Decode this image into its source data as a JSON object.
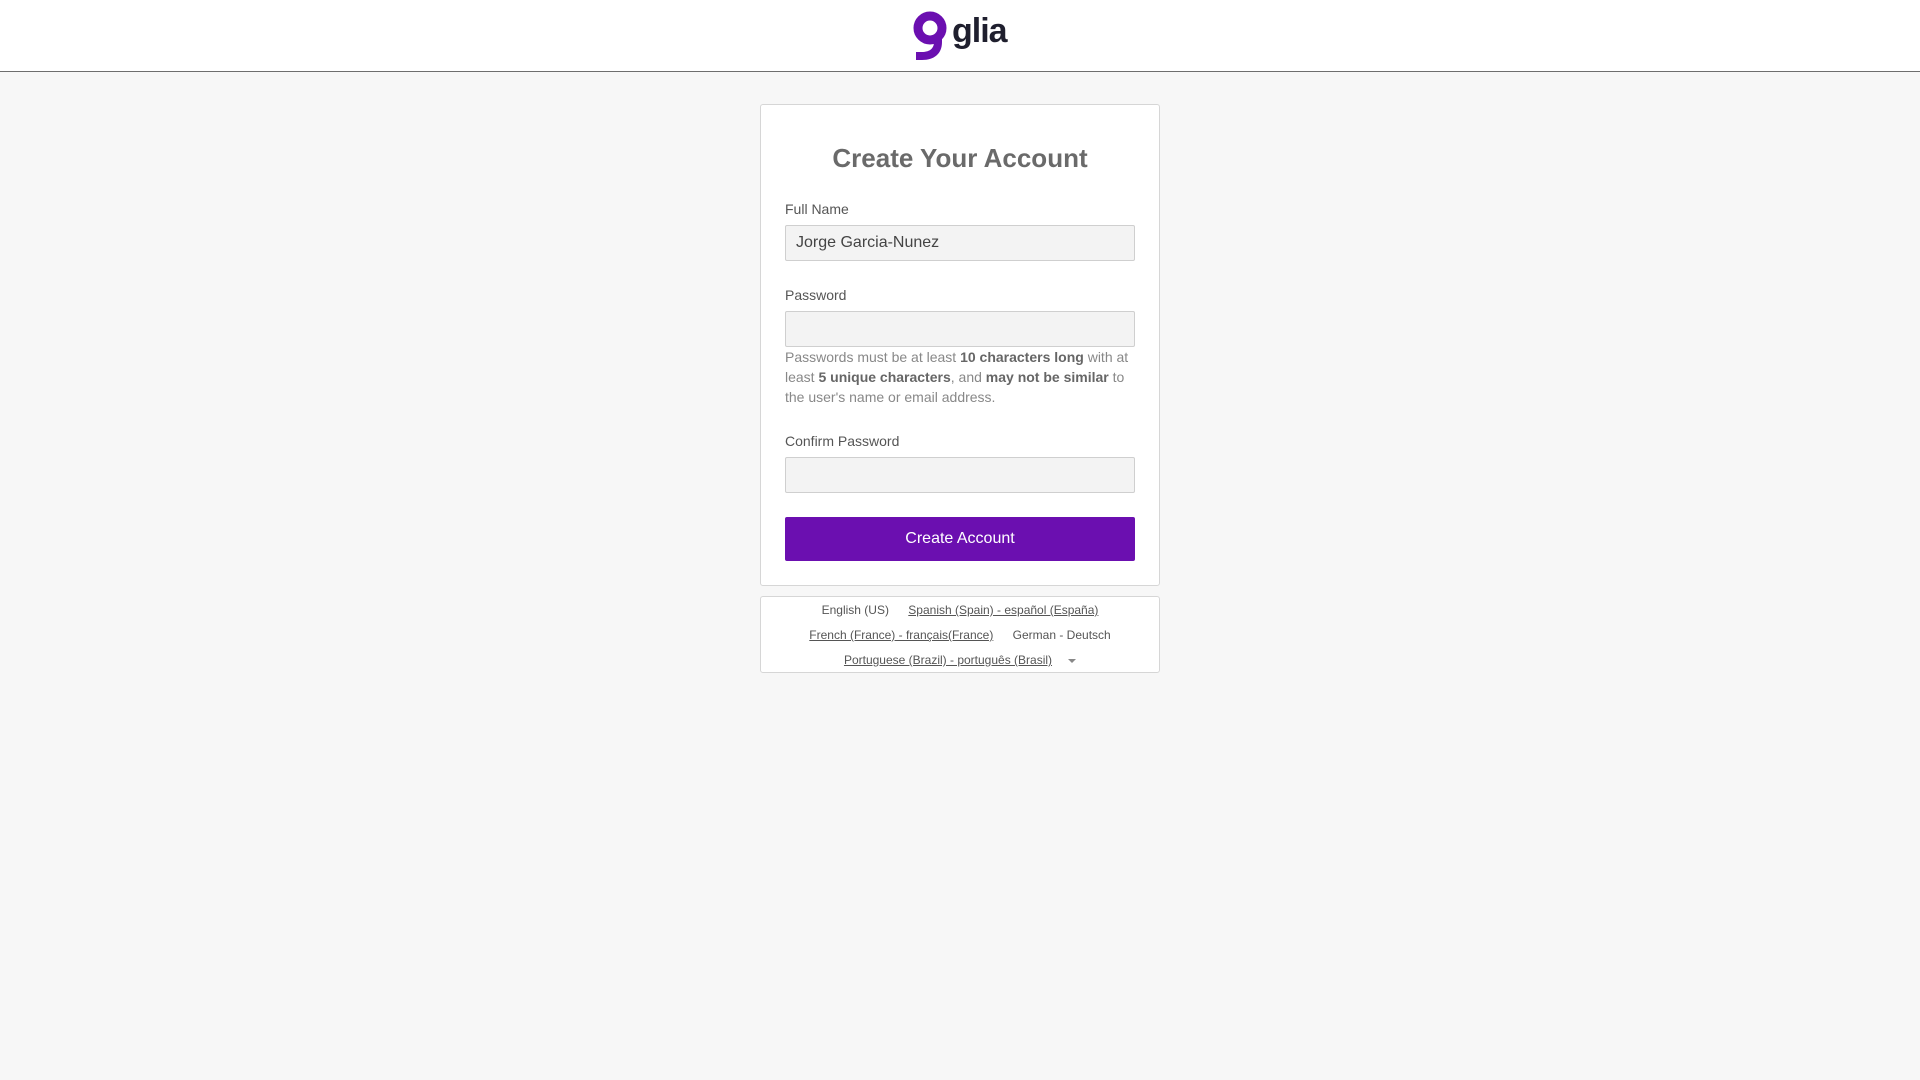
{
  "brand": {
    "name": "glia",
    "accent_color": "#6b0fb0"
  },
  "form": {
    "title": "Create Your Account",
    "full_name": {
      "label": "Full Name",
      "value": "Jorge Garcia-Nunez"
    },
    "password": {
      "label": "Password",
      "value": ""
    },
    "password_hint": {
      "part1": "Passwords must be at least ",
      "bold1": "10 characters long",
      "part2": " with at least ",
      "bold2": "5 unique characters",
      "part3": ", and ",
      "bold3": "may not be similar",
      "part4": " to the user's name or email address."
    },
    "confirm_password": {
      "label": "Confirm Password",
      "value": ""
    },
    "submit_label": "Create Account"
  },
  "languages": {
    "current": "English (US)",
    "options": [
      "Spanish (Spain) - español (España)",
      "French (France) - français(France)",
      "German - Deutsch",
      "Portuguese (Brazil) - português (Brasil)"
    ],
    "more_icon": "chevron-down-icon"
  }
}
